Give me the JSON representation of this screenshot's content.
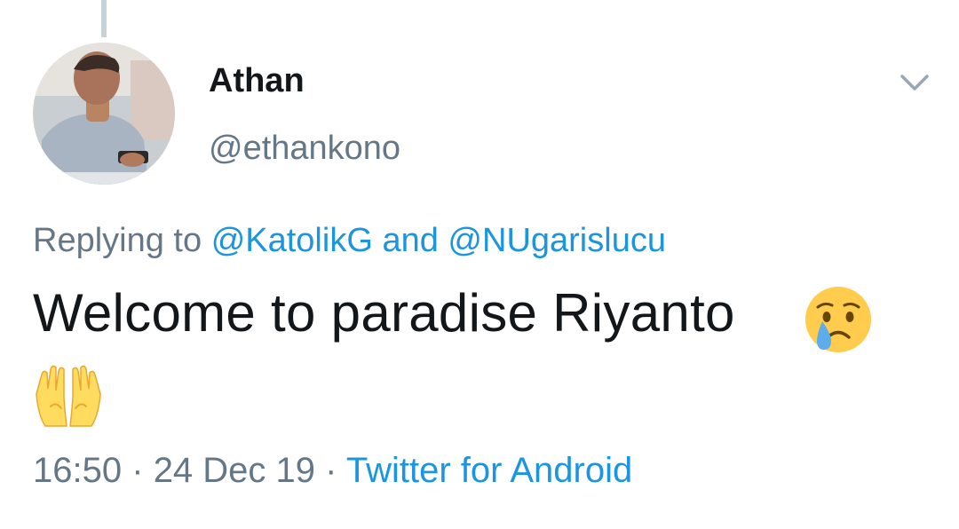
{
  "tweet": {
    "author": {
      "display_name": "Athan",
      "handle": "@ethankono"
    },
    "reply": {
      "prefix": "Replying to",
      "mention1": "@KatolikG",
      "joiner": "and",
      "mention2": "@NUgarislucu"
    },
    "text": "Welcome to paradise Riyanto",
    "emojis": [
      "crying-face",
      "palms-up-together"
    ],
    "meta": {
      "time": "16:50",
      "separator": "·",
      "date": "24 Dec 19",
      "source": "Twitter for Android"
    }
  },
  "colors": {
    "primary_text": "#14171a",
    "secondary_text": "#657786",
    "link": "#1b95e0",
    "thread_line": "#c9d2d9"
  },
  "icons": {
    "menu": "chevron-down-icon",
    "avatar": "avatar"
  }
}
